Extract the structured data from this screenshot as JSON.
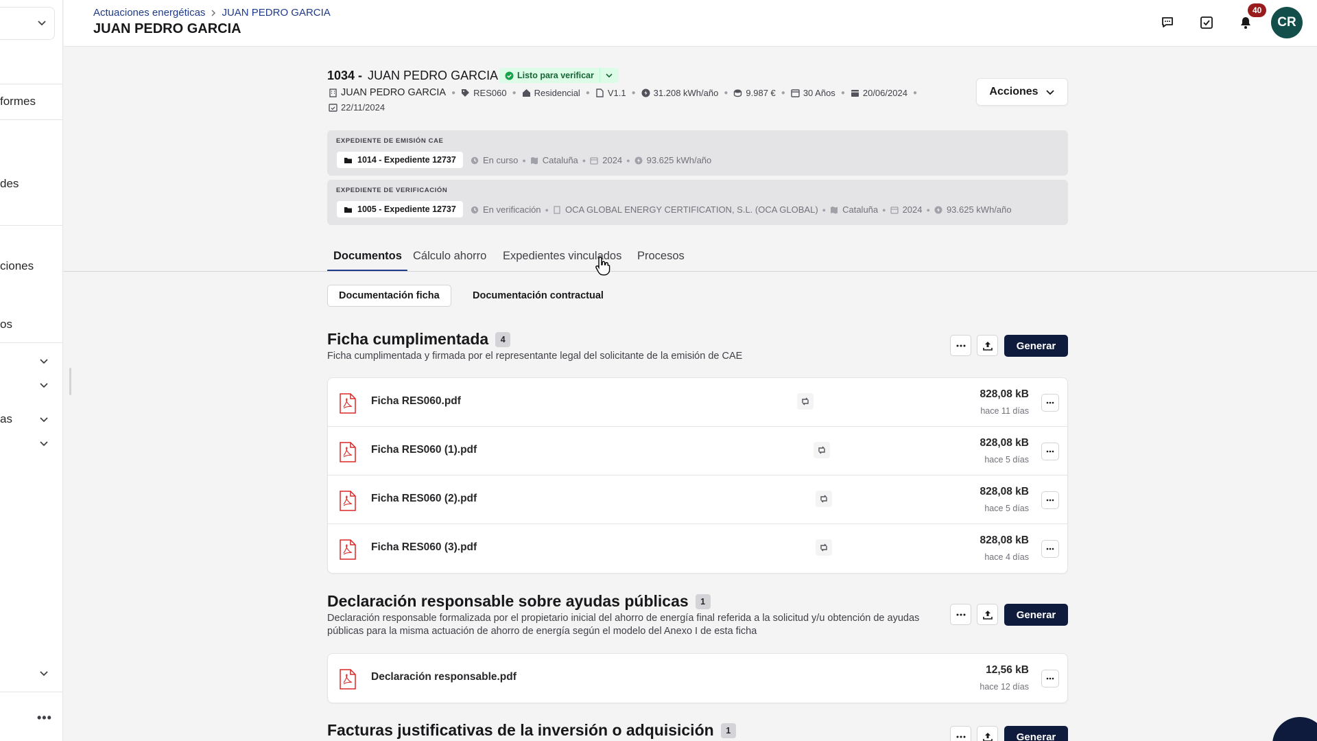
{
  "sidebar": {
    "items": [
      {
        "label": "formes"
      },
      {
        "label": "des"
      },
      {
        "label": "ciones"
      },
      {
        "label": "os"
      },
      {
        "label": "as"
      }
    ]
  },
  "header": {
    "breadcrumb": [
      "Actuaciones energéticas",
      "JUAN PEDRO GARCIA"
    ],
    "title": "JUAN PEDRO GARCIA",
    "notifications_count": "40",
    "avatar_initials": "CR"
  },
  "record": {
    "id": "1034 -",
    "name": "JUAN PEDRO GARCIA",
    "status": "Listo para verificar",
    "meta": {
      "owner": "JUAN PEDRO GARCIA",
      "code": "RES060",
      "type": "Residencial",
      "version": "V1.1",
      "energy": "31.208 kWh/año",
      "amount": "9.987 €",
      "years": "30 Años",
      "date1": "20/06/2024",
      "date2": "22/11/2024"
    },
    "actions_label": "Acciones"
  },
  "expedientes": {
    "emision": {
      "label": "EXPEDIENTE DE EMISIÓN CAE",
      "chip": "1014 - Expediente 12737",
      "status": "En curso",
      "region": "Cataluña",
      "year": "2024",
      "energy": "93.625 kWh/año"
    },
    "verificacion": {
      "label": "EXPEDIENTE DE VERIFICACIÓN",
      "chip": "1005 - Expediente 12737",
      "status": "En verificación",
      "entity": "OCA GLOBAL ENERGY CERTIFICATION, S.L. (OCA GLOBAL)",
      "region": "Cataluña",
      "year": "2024",
      "energy": "93.625 kWh/año"
    }
  },
  "tabs": [
    "Documentos",
    "Cálculo ahorro",
    "Expedientes vinculados",
    "Procesos"
  ],
  "subtabs": [
    "Documentación ficha",
    "Documentación contractual"
  ],
  "generate_label": "Generar",
  "sections": [
    {
      "title": "Ficha cumplimentada",
      "count": "4",
      "description": "Ficha cumplimentada y firmada por el representante legal del solicitante de la emisión de CAE",
      "files": [
        {
          "name": "Ficha RES060.pdf",
          "size": "828,08 kB",
          "date": "hace 11 días"
        },
        {
          "name": "Ficha RES060 (1).pdf",
          "size": "828,08 kB",
          "date": "hace 5 días"
        },
        {
          "name": "Ficha RES060 (2).pdf",
          "size": "828,08 kB",
          "date": "hace 5 días"
        },
        {
          "name": "Ficha RES060 (3).pdf",
          "size": "828,08 kB",
          "date": "hace 4 días"
        }
      ]
    },
    {
      "title": "Declaración responsable sobre ayudas públicas",
      "count": "1",
      "description": "Declaración responsable formalizada por el propietario inicial del ahorro de energía final referida a la solicitud y/u obtención de ayudas públicas para la misma actuación de ahorro de energía según el modelo del Anexo I de esta ficha",
      "files": [
        {
          "name": "Declaración responsable.pdf",
          "size": "12,56 kB",
          "date": "hace 12 días"
        }
      ]
    },
    {
      "title": "Facturas justificativas de la inversión o adquisición",
      "count": "1"
    }
  ],
  "colors": {
    "primary": "#0f1b3d",
    "accent": "#1e3a8a",
    "status_bg": "#dcfce7",
    "status_text": "#166534",
    "badge": "#991b1b",
    "avatar": "#134e4a"
  }
}
